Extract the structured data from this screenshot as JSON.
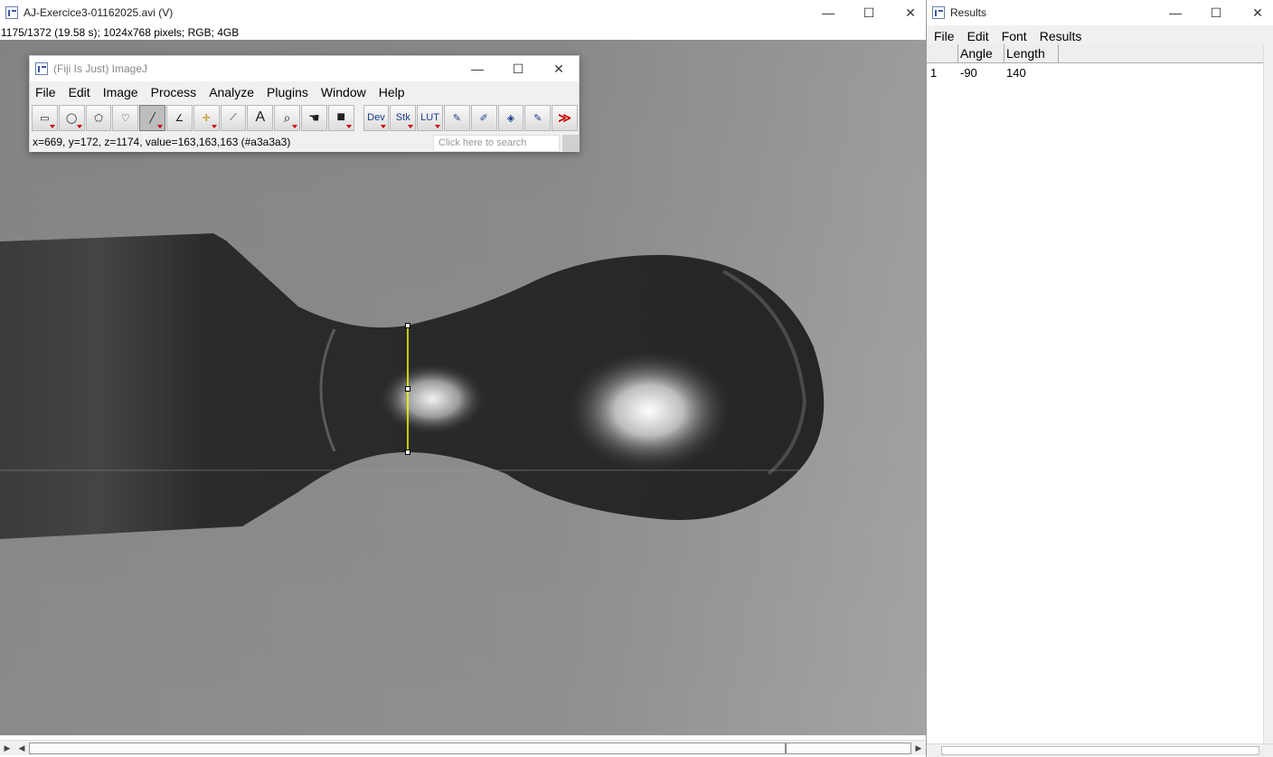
{
  "image_window": {
    "title": "AJ-Exercice3-01162025.avi (V)",
    "info": "1175/1372 (19.58 s); 1024x768 pixels; RGB; 4GB",
    "controls": {
      "minimize": "—",
      "maximize": "☐",
      "close": "✕"
    }
  },
  "fiji_window": {
    "title": "(Fiji Is Just) ImageJ",
    "menu": [
      "File",
      "Edit",
      "Image",
      "Process",
      "Analyze",
      "Plugins",
      "Window",
      "Help"
    ],
    "tools": [
      {
        "name": "rectangle-tool",
        "glyph": "▭"
      },
      {
        "name": "oval-tool",
        "glyph": "◯"
      },
      {
        "name": "polygon-tool",
        "glyph": "⬠"
      },
      {
        "name": "freehand-tool",
        "glyph": "♡"
      },
      {
        "name": "straight-line-tool",
        "glyph": "╱",
        "selected": true
      },
      {
        "name": "angle-tool",
        "glyph": "∠"
      },
      {
        "name": "point-tool",
        "glyph": "✛"
      },
      {
        "name": "wand-tool",
        "glyph": "⟋"
      },
      {
        "name": "text-tool",
        "glyph": "A"
      },
      {
        "name": "magnifier-tool",
        "glyph": "🔍"
      },
      {
        "name": "hand-tool",
        "glyph": "✋"
      },
      {
        "name": "dropper-tool",
        "glyph": "■"
      }
    ],
    "extra_tools": [
      {
        "name": "developer-menu",
        "label": "Dev"
      },
      {
        "name": "stacks-menu",
        "label": "Stk"
      },
      {
        "name": "lut-menu",
        "label": "LUT"
      },
      {
        "name": "pencil-tool",
        "label": "✎"
      },
      {
        "name": "brush-tool",
        "label": "✐"
      },
      {
        "name": "flood-fill-tool",
        "label": "◈"
      },
      {
        "name": "spray-tool",
        "label": "✎"
      },
      {
        "name": "more-tools",
        "label": "≫"
      }
    ],
    "status": "x=669, y=172, z=1174, value=163,163,163 (#a3a3a3)",
    "search_placeholder": "Click here to search"
  },
  "results_window": {
    "title": "Results",
    "menu": [
      "File",
      "Edit",
      "Font",
      "Results"
    ],
    "columns": [
      "",
      "Angle",
      "Length"
    ],
    "rows": [
      [
        "1",
        "-90",
        "140"
      ]
    ]
  },
  "colors": {
    "selection_line": "#ffff00",
    "background_gray": "#8a8a8a"
  }
}
